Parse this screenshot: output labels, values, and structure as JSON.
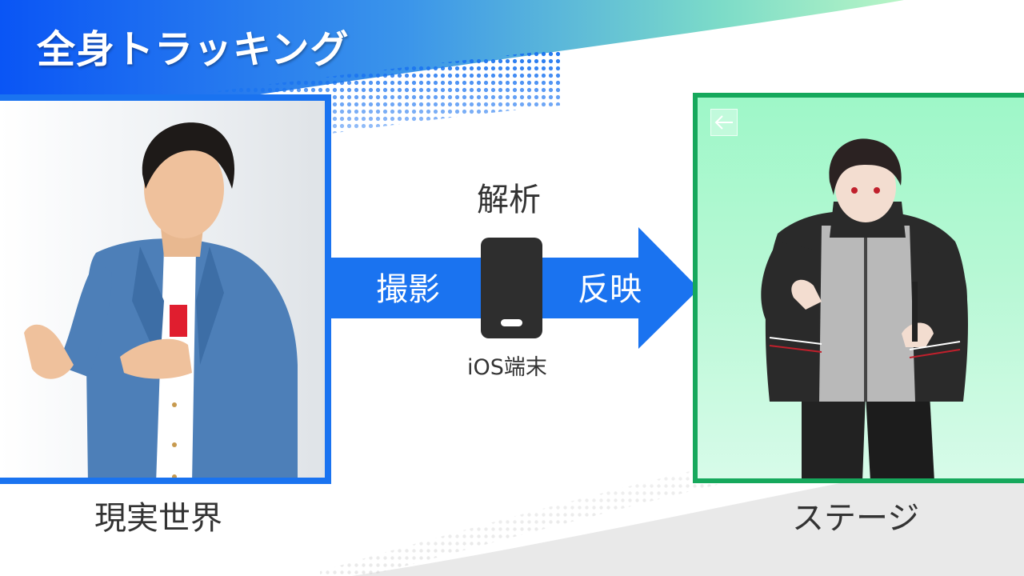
{
  "slide": {
    "title": "全身トラッキング",
    "colors": {
      "accent_blue": "#1a73f0",
      "accent_green": "#16a85c",
      "stage_background": "#a8f7cc",
      "text_dark": "#333333"
    }
  },
  "real_world": {
    "label": "現実世界",
    "image": "person-in-denim-jacket-photo"
  },
  "stage": {
    "label": "ステージ",
    "image": "3d-avatar-in-jacket",
    "back_icon": "arrow-left-icon"
  },
  "flow": {
    "shoot_label": "撮影",
    "analysis_label": "解析",
    "reflect_label": "反映",
    "device_label": "iOS端末",
    "device_icon": "smartphone-icon"
  }
}
